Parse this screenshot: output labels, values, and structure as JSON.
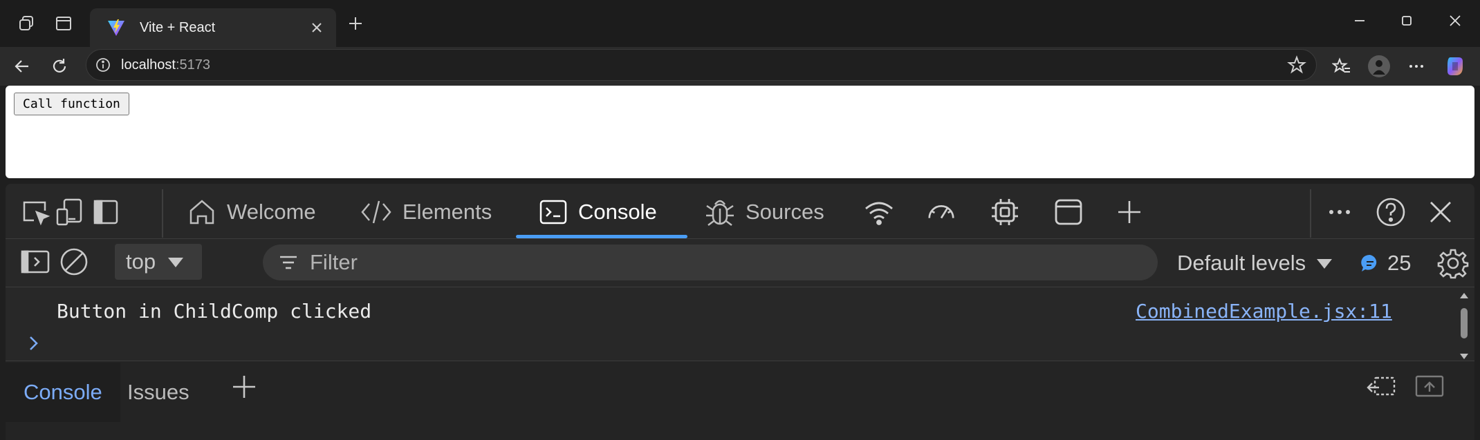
{
  "browser": {
    "tab": {
      "title": "Vite + React"
    },
    "address": {
      "host": "localhost",
      "port": ":5173"
    }
  },
  "page": {
    "call_button_label": "Call function"
  },
  "devtools": {
    "tabs": [
      {
        "label": "Welcome",
        "icon": "home-icon"
      },
      {
        "label": "Elements",
        "icon": "code-icon"
      },
      {
        "label": "Console",
        "icon": "console-icon"
      },
      {
        "label": "Sources",
        "icon": "bug-icon"
      }
    ],
    "console_toolbar": {
      "context": "top",
      "filter_placeholder": "Filter",
      "levels": "Default levels",
      "message_count": "25"
    },
    "log": {
      "message": "Button in ChildComp clicked",
      "source": "CombinedExample.jsx:11"
    },
    "drawer": {
      "tabs": [
        "Console",
        "Issues"
      ]
    }
  },
  "colors": {
    "accent": "#4a9df5",
    "link": "#8ab4f8",
    "active_drawer_tab": "#7cacf8"
  }
}
